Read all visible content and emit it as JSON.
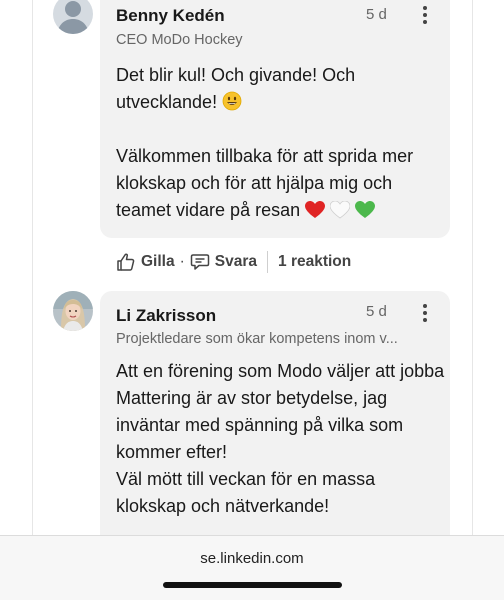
{
  "comments": [
    {
      "author": "Benny Kedén",
      "headline": "CEO MoDo Hockey",
      "time": "5 d",
      "paragraph1": "Det blir kul! Och givande! Och utvecklande!",
      "paragraph2": "Välkommen tillbaka för att sprida mer klokskap och för att hjälpa mig och teamet vidare på resan",
      "emojis": [
        "smiling-face-icon",
        "red-heart-icon",
        "white-heart-icon",
        "green-heart-icon"
      ]
    },
    {
      "author": "Li Zakrisson",
      "headline": "Projektledare som ökar kompetens inom v...",
      "time": "5 d",
      "body": "Att en förening som Modo väljer att jobba Mattering är av stor betydelse, jag inväntar med spänning på vilka som kommer efter!\nVäl mött till veckan för en massa klokskap och nätverkande!"
    }
  ],
  "actions": {
    "like_label": "Gilla",
    "dot": "·",
    "reply_label": "Svara",
    "reactions_label": "1 reaktion"
  },
  "browser": {
    "url": "se.linkedin.com"
  },
  "colors": {
    "bubble": "#f2f2f2",
    "secondary_text": "#666666"
  }
}
